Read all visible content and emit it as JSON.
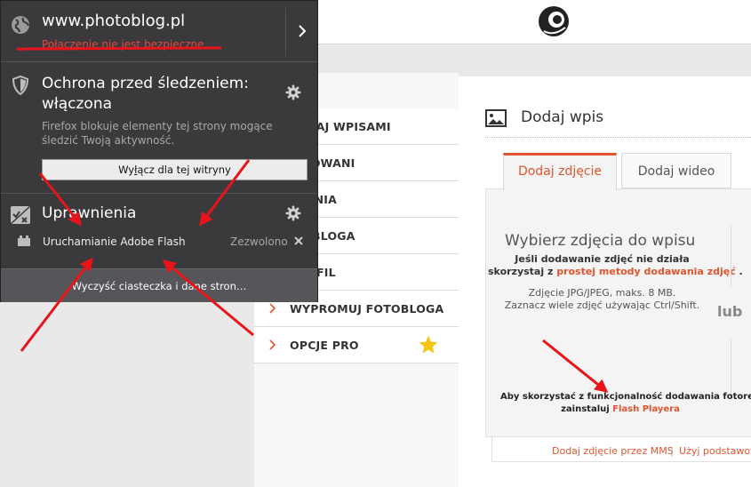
{
  "popup": {
    "host": "www.photoblog.pl",
    "connection_status": "Połączenie nie jest bezpieczne",
    "tracking": {
      "title": "Ochrona przed śledzeniem: włączona",
      "description": "Firefox blokuje elementy tej strony mogące śledzić Twoją aktywność.",
      "button_pre": "Wy",
      "button_u": "ł",
      "button_post": "ącz dla tej witryny"
    },
    "permissions": {
      "title": "Uprawnienia",
      "items": [
        {
          "name": "Uruchamianie Adobe Flash",
          "state": "Zezwolono"
        }
      ]
    },
    "clear_cookies": "Wyczyść ciasteczka i dane stron…"
  },
  "menu": {
    "items": [
      {
        "label": "ĄDZAJ WPISAMI"
      },
      {
        "label": "RWOWANI"
      },
      {
        "label": "WIENIA"
      },
      {
        "label": "ĄD BLOGA"
      },
      {
        "label": "PROFIL"
      },
      {
        "label": "WYPROMUJ FOTOBLOGA"
      },
      {
        "label": "OPCJE PRO"
      }
    ]
  },
  "main": {
    "title": "Dodaj wpis",
    "tabs": [
      {
        "label": "Dodaj zdjęcie"
      },
      {
        "label": "Dodaj wideo"
      }
    ],
    "upload": {
      "title": "Wybierz zdjęcia do wpisu",
      "line1": "Jeśli dodawanie zdjęć nie działa",
      "line2_pre": "skorzystaj z ",
      "line2_link": "prostej metody dodawania zdjęć",
      "line2_post": " .",
      "info1": "Zdjęcie JPG/JPEG, maks. 8 MB.",
      "info2": "Zaznacz wiele zdjęć używając Ctrl/Shift.",
      "or": "lub",
      "flash_line1": "Aby skorzystać z funkcjonalność dodawania fotorelacji",
      "flash_line2_pre": "zainstaluj ",
      "flash_line2_link": "Flash Playera"
    },
    "bottom_links": {
      "mms": "Dodaj zdjęcie przez MMS",
      "separator": "|",
      "basic": "Użyj podstawow"
    }
  },
  "colors": {
    "accent": "#e0552e",
    "popup_bg": "#3a3a3d",
    "insecure": "#e5463f",
    "annotation": "#e8141a",
    "star": "#f5c518"
  }
}
